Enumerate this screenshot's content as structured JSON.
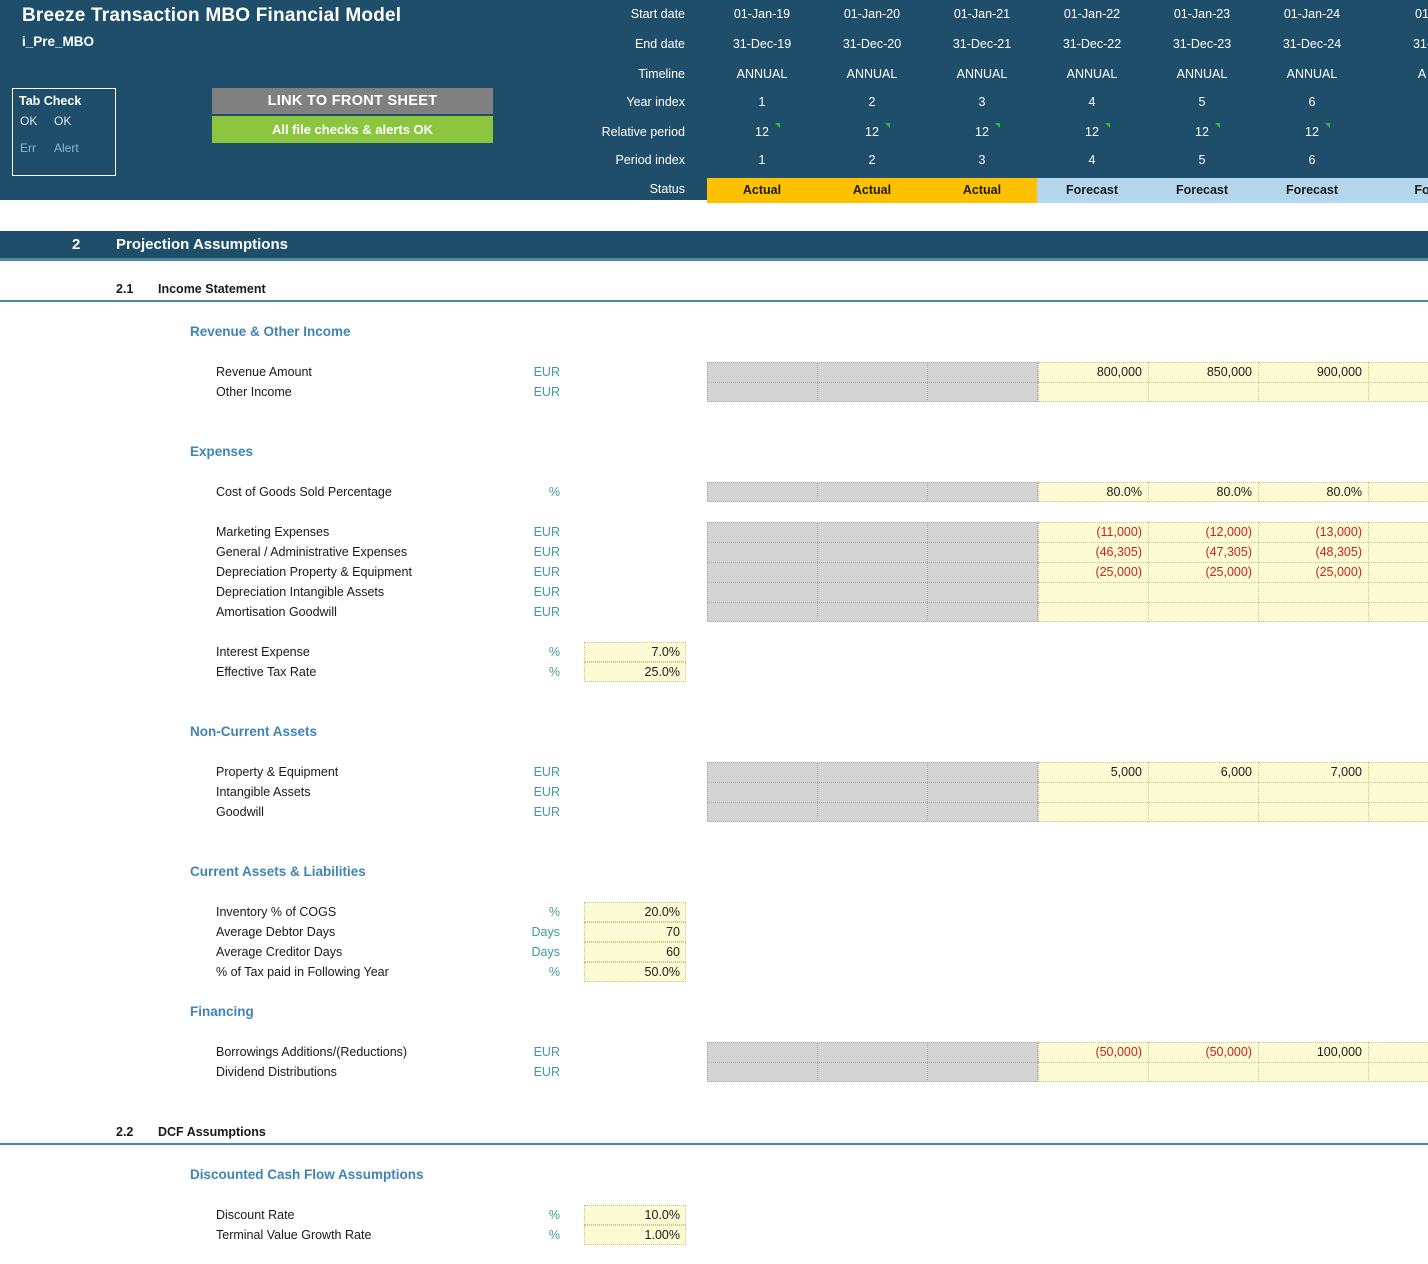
{
  "header": {
    "title": "Breeze Transaction MBO Financial Model",
    "subtitle": "i_Pre_MBO",
    "tab_check": {
      "title": "Tab Check",
      "ok_left": "OK",
      "ok_right": "OK",
      "err_label": "Err",
      "alert_label": "Alert"
    },
    "buttons": {
      "front_sheet": "LINK TO FRONT SHEET",
      "checks_ok": "All file checks & alerts OK"
    },
    "row_labels": [
      "Start date",
      "End date",
      "Timeline",
      "Year index",
      "Relative period",
      "Period index",
      "Status"
    ],
    "colors": {
      "band": "#1f4e6b",
      "actual": "#ffc000",
      "forecast": "#b4d6ed",
      "front_sheet_button": "#808080",
      "checks_button": "#8cc63e"
    },
    "periods": [
      {
        "start_date": "01-Jan-19",
        "end_date": "31-Dec-19",
        "timeline": "ANNUAL",
        "year_index": "1",
        "relative_period": "12",
        "period_index": "1",
        "status": "Actual"
      },
      {
        "start_date": "01-Jan-20",
        "end_date": "31-Dec-20",
        "timeline": "ANNUAL",
        "year_index": "2",
        "relative_period": "12",
        "period_index": "2",
        "status": "Actual"
      },
      {
        "start_date": "01-Jan-21",
        "end_date": "31-Dec-21",
        "timeline": "ANNUAL",
        "year_index": "3",
        "relative_period": "12",
        "period_index": "3",
        "status": "Actual"
      },
      {
        "start_date": "01-Jan-22",
        "end_date": "31-Dec-22",
        "timeline": "ANNUAL",
        "year_index": "4",
        "relative_period": "12",
        "period_index": "4",
        "status": "Forecast"
      },
      {
        "start_date": "01-Jan-23",
        "end_date": "31-Dec-23",
        "timeline": "ANNUAL",
        "year_index": "5",
        "relative_period": "12",
        "period_index": "5",
        "status": "Forecast"
      },
      {
        "start_date": "01-Jan-24",
        "end_date": "31-Dec-24",
        "timeline": "ANNUAL",
        "year_index": "6",
        "relative_period": "12",
        "period_index": "6",
        "status": "Forecast"
      },
      {
        "start_date": "01",
        "end_date": "31-",
        "timeline": "A",
        "year_index": "",
        "relative_period": "",
        "period_index": "",
        "status": "Fo"
      }
    ]
  },
  "section1": {
    "number": "2",
    "title": "Projection Assumptions"
  },
  "section_21": {
    "number": "2.1",
    "title": "Income Statement"
  },
  "groups": {
    "revenue": {
      "title": "Revenue & Other Income",
      "rows": [
        {
          "label": "Revenue Amount",
          "unit": "EUR",
          "values": [
            "800,000",
            "850,000",
            "900,000",
            "9"
          ]
        },
        {
          "label": "Other Income",
          "unit": "EUR",
          "values": [
            "",
            "",
            "",
            ""
          ]
        }
      ]
    },
    "expenses": {
      "title": "Expenses",
      "cogs": {
        "label": "Cost of Goods Sold Percentage",
        "unit": "%",
        "values": [
          "80.0%",
          "80.0%",
          "80.0%",
          ""
        ]
      },
      "rows": [
        {
          "label": "Marketing Expenses",
          "unit": "EUR",
          "values": [
            "(11,000)",
            "(12,000)",
            "(13,000)",
            "("
          ],
          "negative": true
        },
        {
          "label": "General / Administrative Expenses",
          "unit": "EUR",
          "values": [
            "(46,305)",
            "(47,305)",
            "(48,305)",
            "("
          ],
          "negative": true
        },
        {
          "label": "Depreciation Property & Equipment",
          "unit": "EUR",
          "values": [
            "(25,000)",
            "(25,000)",
            "(25,000)",
            "("
          ],
          "negative": true
        },
        {
          "label": "Depreciation Intangible Assets",
          "unit": "EUR",
          "values": [
            "",
            "",
            "",
            ""
          ],
          "negative": false
        },
        {
          "label": "Amortisation Goodwill",
          "unit": "EUR",
          "values": [
            "",
            "",
            "",
            ""
          ],
          "negative": false
        }
      ],
      "inputs": [
        {
          "label": "Interest Expense",
          "unit": "%",
          "value": "7.0%"
        },
        {
          "label": "Effective Tax Rate",
          "unit": "%",
          "value": "25.0%"
        }
      ]
    },
    "noncurrent_assets": {
      "title": "Non-Current Assets",
      "rows": [
        {
          "label": "Property & Equipment",
          "unit": "EUR",
          "values": [
            "5,000",
            "6,000",
            "7,000",
            ""
          ]
        },
        {
          "label": "Intangible Assets",
          "unit": "EUR",
          "values": [
            "",
            "",
            "",
            ""
          ]
        },
        {
          "label": "Goodwill",
          "unit": "EUR",
          "values": [
            "",
            "",
            "",
            ""
          ]
        }
      ]
    },
    "current_assets": {
      "title": "Current Assets & Liabilities",
      "inputs": [
        {
          "label": "Inventory % of COGS",
          "unit": "%",
          "value": "20.0%"
        },
        {
          "label": "Average Debtor Days",
          "unit": "Days",
          "value": "70"
        },
        {
          "label": "Average Creditor Days",
          "unit": "Days",
          "value": "60"
        },
        {
          "label": "% of Tax paid in Following Year",
          "unit": "%",
          "value": "50.0%"
        }
      ]
    },
    "financing": {
      "title": "Financing",
      "rows": [
        {
          "label": "Borrowings Additions/(Reductions)",
          "unit": "EUR",
          "values": [
            "(50,000)",
            "(50,000)",
            "100,000",
            ""
          ],
          "neg_flags": [
            true,
            true,
            false,
            false
          ]
        },
        {
          "label": "Dividend Distributions",
          "unit": "EUR",
          "values": [
            "",
            "",
            "",
            ""
          ],
          "neg_flags": [
            false,
            false,
            false,
            false
          ]
        }
      ]
    }
  },
  "section_22": {
    "number": "2.2",
    "title": "DCF Assumptions"
  },
  "dcf": {
    "title": "Discounted Cash Flow Assumptions",
    "inputs": [
      {
        "label": "Discount Rate",
        "unit": "%",
        "value": "10.0%"
      },
      {
        "label": "Terminal Value Growth Rate",
        "unit": "%",
        "value": "1.00%"
      }
    ]
  }
}
